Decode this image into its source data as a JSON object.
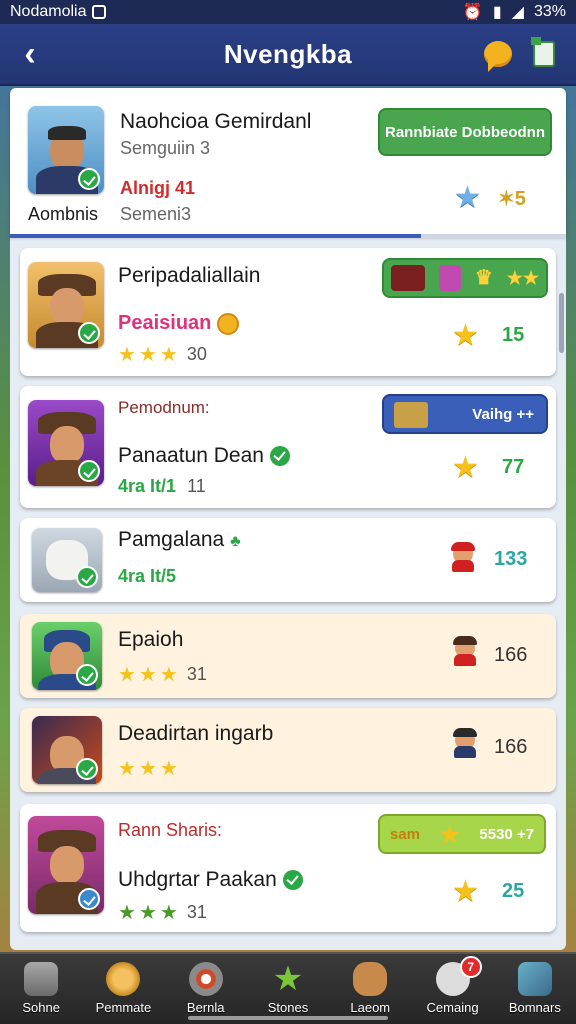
{
  "status_bar": {
    "carrier": "Nodamolia",
    "battery": "33%"
  },
  "header": {
    "title": "Nvengkba"
  },
  "featured": {
    "name": "Naohcioa Gemirdanl",
    "sub": "Semguiin 3",
    "alert": "Alnigj 41",
    "team": "Aombnis",
    "season": "Semeni3",
    "action_label": "Rannbiate Dobbeodnn",
    "score": "5",
    "progress_percent": 74
  },
  "rows": [
    {
      "name": "Peripadaliallain",
      "tag": "Peaisiuan",
      "rating_count": "30",
      "score": "15",
      "pill": "",
      "tone": "white"
    },
    {
      "label": "Pemodnum:",
      "name": "Panaatun Dean",
      "tag": "4ra It/1",
      "rating_count": "11",
      "score": "77",
      "pill": "Vaihg ++",
      "tone": "white"
    },
    {
      "name": "Pamgalana",
      "tag": "4ra It/5",
      "score": "133",
      "tone": "white"
    },
    {
      "name": "Epaioh",
      "rating_count": "31",
      "score": "166",
      "tone": "cream"
    },
    {
      "name": "Deadirtan ingarb",
      "score": "166",
      "tone": "cream"
    },
    {
      "label": "Rann Sharis:",
      "name": "Uhdgrtar Paakan",
      "rating_count": "31",
      "score": "25",
      "pill": "5530 +7",
      "pill_prefix": "sam",
      "tone": "white"
    }
  ],
  "nav": [
    {
      "label": "Sohne",
      "icon": "house-icon"
    },
    {
      "label": "Pemmate",
      "icon": "magnifier-icon"
    },
    {
      "label": "Bernla",
      "icon": "target-icon"
    },
    {
      "label": "Stones",
      "icon": "star-icon"
    },
    {
      "label": "Laeom",
      "icon": "bear-icon"
    },
    {
      "label": "Cemaing",
      "icon": "chat-icon",
      "badge": "7"
    },
    {
      "label": "Bomnars",
      "icon": "pencil-icon"
    }
  ],
  "colors": {
    "header": "#2a3f86",
    "accent_green": "#3ca34a",
    "pill_blue": "#3a5fb8",
    "star": "#f5c21b"
  }
}
